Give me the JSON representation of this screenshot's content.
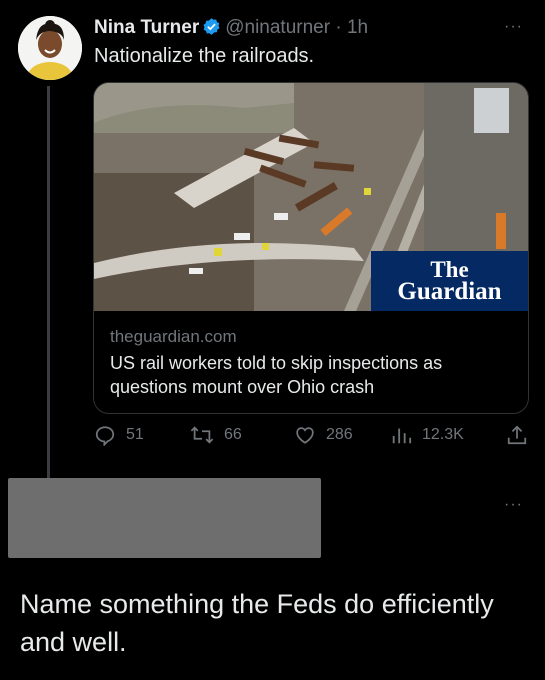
{
  "tweet": {
    "author_name": "Nina Turner",
    "handle": "@ninaturner",
    "separator": "·",
    "time": "1h",
    "text": "Nationalize the railroads.",
    "more_label": "···"
  },
  "card": {
    "logo_line1": "The",
    "logo_line2": "Guardian",
    "domain": "theguardian.com",
    "title": "US rail workers told to skip inspections as questions mount over Ohio crash"
  },
  "actions": {
    "replies": "51",
    "retweets": "66",
    "likes": "286",
    "views": "12.3K"
  },
  "reply": {
    "more_label": "···",
    "text": "Name something the Feds do efficiently and well."
  },
  "colors": {
    "background": "#000000",
    "text": "#e7e9ea",
    "muted": "#71767b",
    "verified": "#1d9bf0",
    "guardian": "#052962"
  }
}
